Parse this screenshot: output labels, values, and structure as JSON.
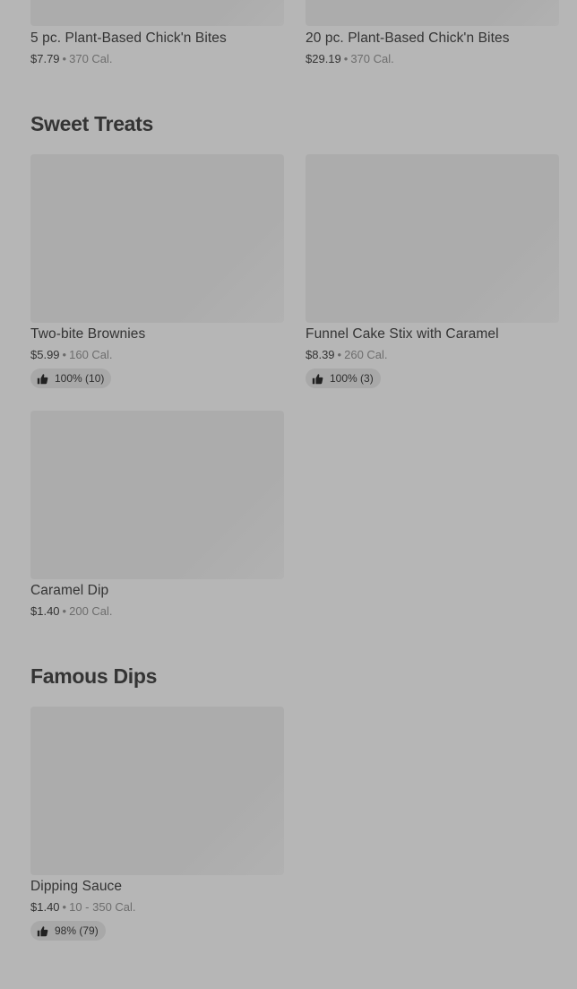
{
  "top_items": [
    {
      "name": "5 pc. Plant-Based Chick'n Bites",
      "price": "$7.79",
      "calories": "370 Cal."
    },
    {
      "name": "20 pc. Plant-Based Chick'n Bites",
      "price": "$29.19",
      "calories": "370 Cal."
    }
  ],
  "sections": [
    {
      "title": "Sweet Treats",
      "items": [
        {
          "name": "Two-bite Brownies",
          "price": "$5.99",
          "calories": "160 Cal.",
          "rating": "100% (10)"
        },
        {
          "name": "Funnel Cake Stix with Caramel",
          "price": "$8.39",
          "calories": "260 Cal.",
          "rating": "100% (3)"
        },
        {
          "name": "Caramel Dip",
          "price": "$1.40",
          "calories": "200 Cal."
        }
      ]
    },
    {
      "title": "Famous Dips",
      "items": [
        {
          "name": "Dipping Sauce",
          "price": "$1.40",
          "calories": "10 - 350 Cal.",
          "rating": "98% (79)"
        }
      ]
    }
  ],
  "separator": "•",
  "icons": {
    "rating": "thumbs-up-icon"
  },
  "colors": {
    "background": "#b6b6b6",
    "image_placeholder": "#acacac",
    "rating_pill": "#a8a8a8"
  }
}
